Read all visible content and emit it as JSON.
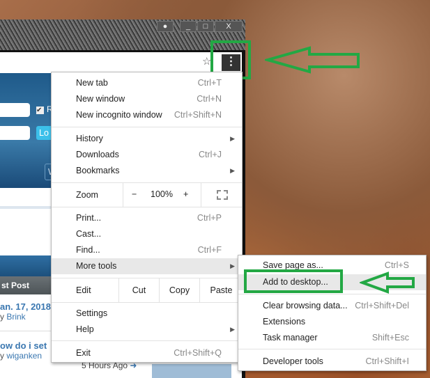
{
  "window_controls": {
    "user": "user-icon",
    "minimize": "_",
    "maximize": "□",
    "close": "X"
  },
  "page": {
    "remember_checkbox_label": "R",
    "login_button": "Lo",
    "w_button": "W",
    "last_post_header": "st Post",
    "posts": [
      {
        "title": "an. 17, 2018",
        "by": "y",
        "user": "Brink"
      },
      {
        "title": "ow do i set",
        "by": "y",
        "user": "wiganken",
        "time": "5 Hours Ago"
      }
    ]
  },
  "menu": {
    "new_tab": {
      "label": "New tab",
      "shortcut": "Ctrl+T"
    },
    "new_window": {
      "label": "New window",
      "shortcut": "Ctrl+N"
    },
    "incognito": {
      "label": "New incognito window",
      "shortcut": "Ctrl+Shift+N"
    },
    "history": {
      "label": "History"
    },
    "downloads": {
      "label": "Downloads",
      "shortcut": "Ctrl+J"
    },
    "bookmarks": {
      "label": "Bookmarks"
    },
    "zoom": {
      "label": "Zoom",
      "minus": "−",
      "value": "100%",
      "plus": "+"
    },
    "print": {
      "label": "Print...",
      "shortcut": "Ctrl+P"
    },
    "cast": {
      "label": "Cast..."
    },
    "find": {
      "label": "Find...",
      "shortcut": "Ctrl+F"
    },
    "more_tools": {
      "label": "More tools"
    },
    "edit": {
      "label": "Edit",
      "cut": "Cut",
      "copy": "Copy",
      "paste": "Paste"
    },
    "settings": {
      "label": "Settings"
    },
    "help": {
      "label": "Help"
    },
    "exit": {
      "label": "Exit",
      "shortcut": "Ctrl+Shift+Q"
    }
  },
  "submenu": {
    "save_page": {
      "label": "Save page as...",
      "shortcut": "Ctrl+S"
    },
    "add_desktop": {
      "label": "Add to desktop..."
    },
    "clear_data": {
      "label": "Clear browsing data...",
      "shortcut": "Ctrl+Shift+Del"
    },
    "extensions": {
      "label": "Extensions"
    },
    "task_manager": {
      "label": "Task manager",
      "shortcut": "Shift+Esc"
    },
    "dev_tools": {
      "label": "Developer tools",
      "shortcut": "Ctrl+Shift+I"
    }
  },
  "annotation_color": "#23a844"
}
